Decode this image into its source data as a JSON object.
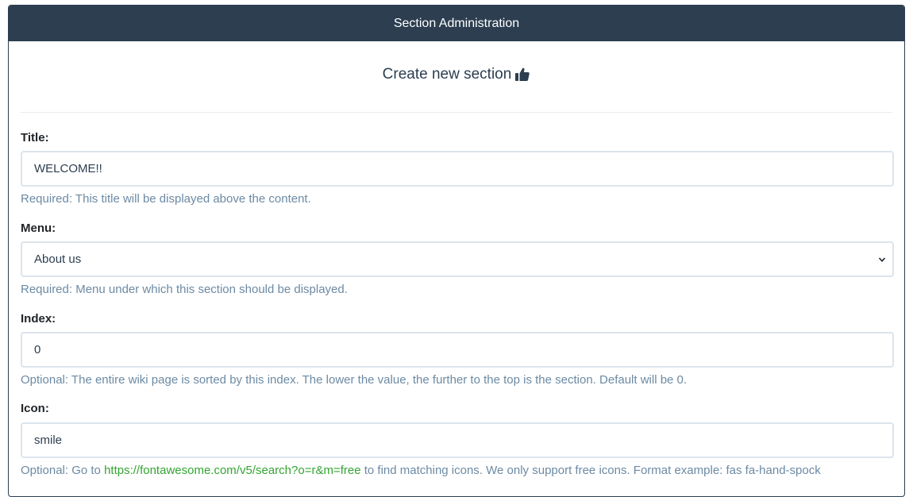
{
  "header": {
    "title": "Section Administration"
  },
  "page": {
    "title": "Create new section",
    "title_icon": "thumbs-up-icon"
  },
  "form": {
    "title": {
      "label": "Title:",
      "value": "WELCOME!!",
      "help": "Required: This title will be displayed above the content."
    },
    "menu": {
      "label": "Menu:",
      "selected": "About us",
      "help": "Required: Menu under which this section should be displayed."
    },
    "index": {
      "label": "Index:",
      "value": "0",
      "help": "Optional: The entire wiki page is sorted by this index. The lower the value, the further to the top is the section. Default will be 0."
    },
    "icon": {
      "label": "Icon:",
      "value": "smile",
      "help_prefix": "Optional: Go to ",
      "help_link": "https://fontawesome.com/v5/search?o=r&m=free",
      "help_suffix": " to find matching icons. We only support free icons. Format example: fas fa-hand-spock"
    }
  },
  "colors": {
    "header_bg": "#2c3e50",
    "help_text": "#6c8aa4",
    "link": "#33a532",
    "input_border": "#dce4ec"
  }
}
